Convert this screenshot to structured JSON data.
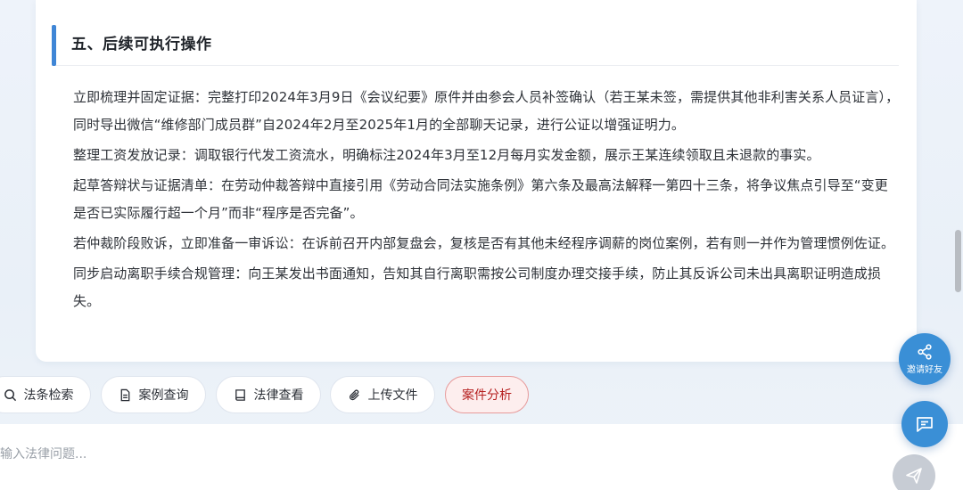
{
  "section": {
    "title": "五、后续可执行操作"
  },
  "paragraphs": [
    "立即梳理并固定证据：完整打印2024年3月9日《会议纪要》原件并由参会人员补签确认（若王某未签，需提供其他非利害关系人员证言），同时导出微信“维修部门成员群”自2024年2月至2025年1月的全部聊天记录，进行公证以增强证明力。",
    "整理工资发放记录：调取银行代发工资流水，明确标注2024年3月至12月每月实发金额，展示王某连续领取且未退款的事实。",
    "起草答辩状与证据清单：在劳动仲裁答辩中直接引用《劳动合同法实施条例》第六条及最高法解释一第四十三条，将争议焦点引导至“变更是否已实际履行超一个月”而非“程序是否完备”。",
    "若仲裁阶段败诉，立即准备一审诉讼：在诉前召开内部复盘会，复核是否有其他未经程序调薪的岗位案例，若有则一并作为管理惯例佐证。",
    "同步启动离职手续合规管理：向王某发出书面通知，告知其自行离职需按公司制度办理交接手续，防止其反诉公司未出具离职证明造成损失。"
  ],
  "toolbar": {
    "search_law": "法条检索",
    "case_query": "案例查询",
    "law_view": "法律查看",
    "upload": "上传文件",
    "case_analysis": "案件分析"
  },
  "input": {
    "placeholder": "输入法律问题..."
  },
  "fab": {
    "invite_label": "邀请好友"
  },
  "colors": {
    "accent": "#3f86d6",
    "fab": "#3a8fd6",
    "active_chip_bg": "#fdeeee",
    "active_chip_text": "#b51e1e"
  }
}
